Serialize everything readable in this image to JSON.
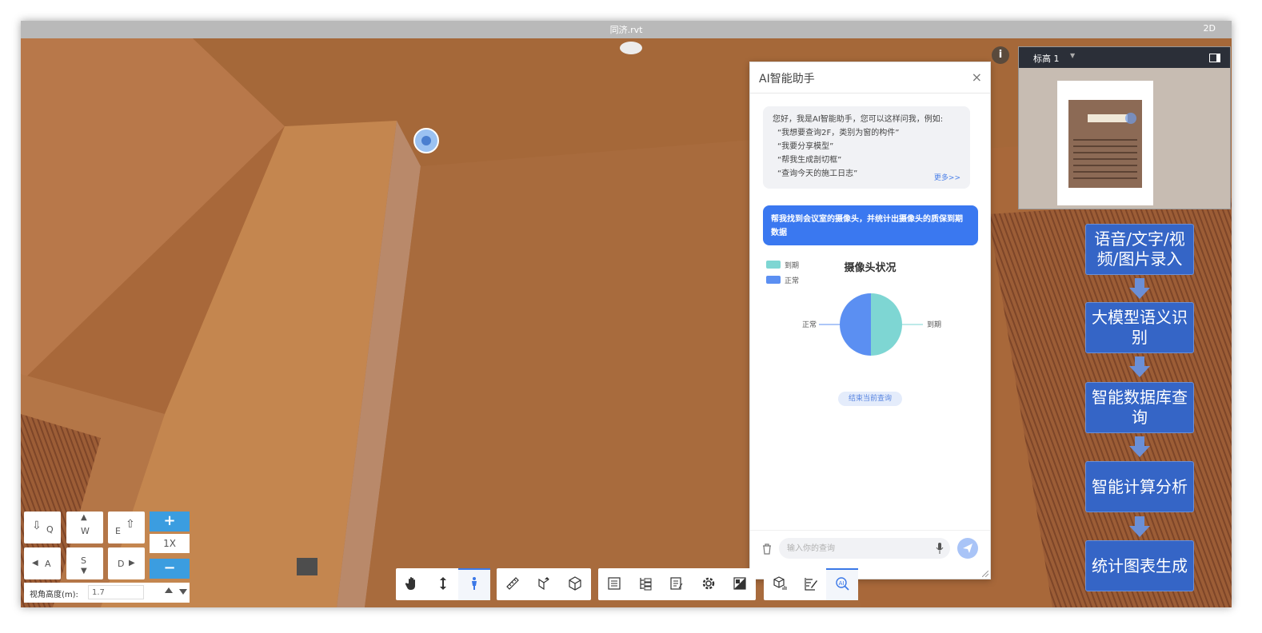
{
  "window": {
    "title": "同济.rvt",
    "view_mode": "2D"
  },
  "ai_panel": {
    "title": "AI智能助手",
    "intro_lines": [
      "您好，我是AI智能助手，您可以这样问我，例如:",
      "“我想要查询2F，类别为窗的构件”",
      "“我要分享模型”",
      "“帮我生成剖切框”",
      "“查询今天的施工日志”"
    ],
    "more_link": "更多>>",
    "user_message": "帮我找到会议室的摄像头，并统计出摄像头的质保到期数据",
    "end_query_label": "结束当前查询",
    "input_placeholder": "输入你的查询"
  },
  "chart_data": {
    "type": "pie",
    "title": "摄像头状况",
    "categories": [
      "到期",
      "正常"
    ],
    "values": [
      50,
      50
    ],
    "colors": [
      "#7ed6d3",
      "#5b8ff2"
    ],
    "legend": [
      "到期",
      "正常"
    ],
    "legend_position": "top-left",
    "labels": [
      "到期",
      "正常"
    ]
  },
  "minimap": {
    "level_label": "标高 1"
  },
  "flowchart": {
    "steps": [
      "语音/文字/视频/图片录入",
      "大模型语义识别",
      "智能数据库查询",
      "智能计算分析",
      "统计图表生成"
    ]
  },
  "movement": {
    "keys": {
      "q": "Q",
      "w": "W",
      "e": "E",
      "a": "A",
      "s": "S",
      "d": "D"
    },
    "zoom_in": "+",
    "zoom_out": "−",
    "zoom_level": "1X",
    "height_label": "视角高度(m):",
    "height_value": "1.7"
  },
  "toolbar": {
    "groups": [
      [
        "pan-hand",
        "vertical-move",
        "walk-person"
      ],
      [
        "measure-ruler",
        "section-tool",
        "model-cube"
      ],
      [
        "properties-list",
        "structure-tree",
        "notes-list",
        "settings-gear",
        "contrast-toggle"
      ],
      [
        "model-stats",
        "sign-edit",
        "ai-search"
      ]
    ]
  },
  "colors": {
    "accent": "#3a78f0",
    "flow_box": "#3565c6",
    "toolbar_active": "#3b78e7"
  }
}
